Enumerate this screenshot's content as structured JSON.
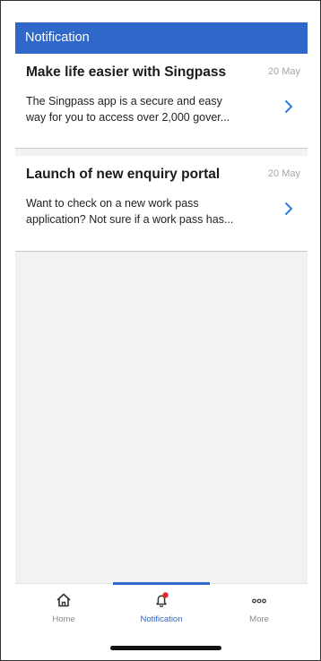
{
  "header": {
    "title": "Notification",
    "color": "#2f68c8"
  },
  "notifications": [
    {
      "title": "Make life easier with Singpass",
      "date": "20 May",
      "body_line_1": "The Singpass app is a secure and easy",
      "body_line_2": "way for you to access over 2,000 gover...",
      "icon": "chevron-right-icon"
    },
    {
      "title": "Launch of new enquiry portal",
      "date": "20 May",
      "body_line_1": "Want to check on a new work pass",
      "body_line_2": "application? Not sure if a work pass has...",
      "icon": "chevron-right-icon"
    }
  ],
  "tab_bar": {
    "active": "Notification",
    "items": [
      {
        "label": "Home",
        "icon": "home-icon"
      },
      {
        "label": "Notification",
        "icon": "bell-icon",
        "badge_color": "#e8252b"
      },
      {
        "label": "More",
        "icon": "more-dots-icon"
      }
    ]
  }
}
